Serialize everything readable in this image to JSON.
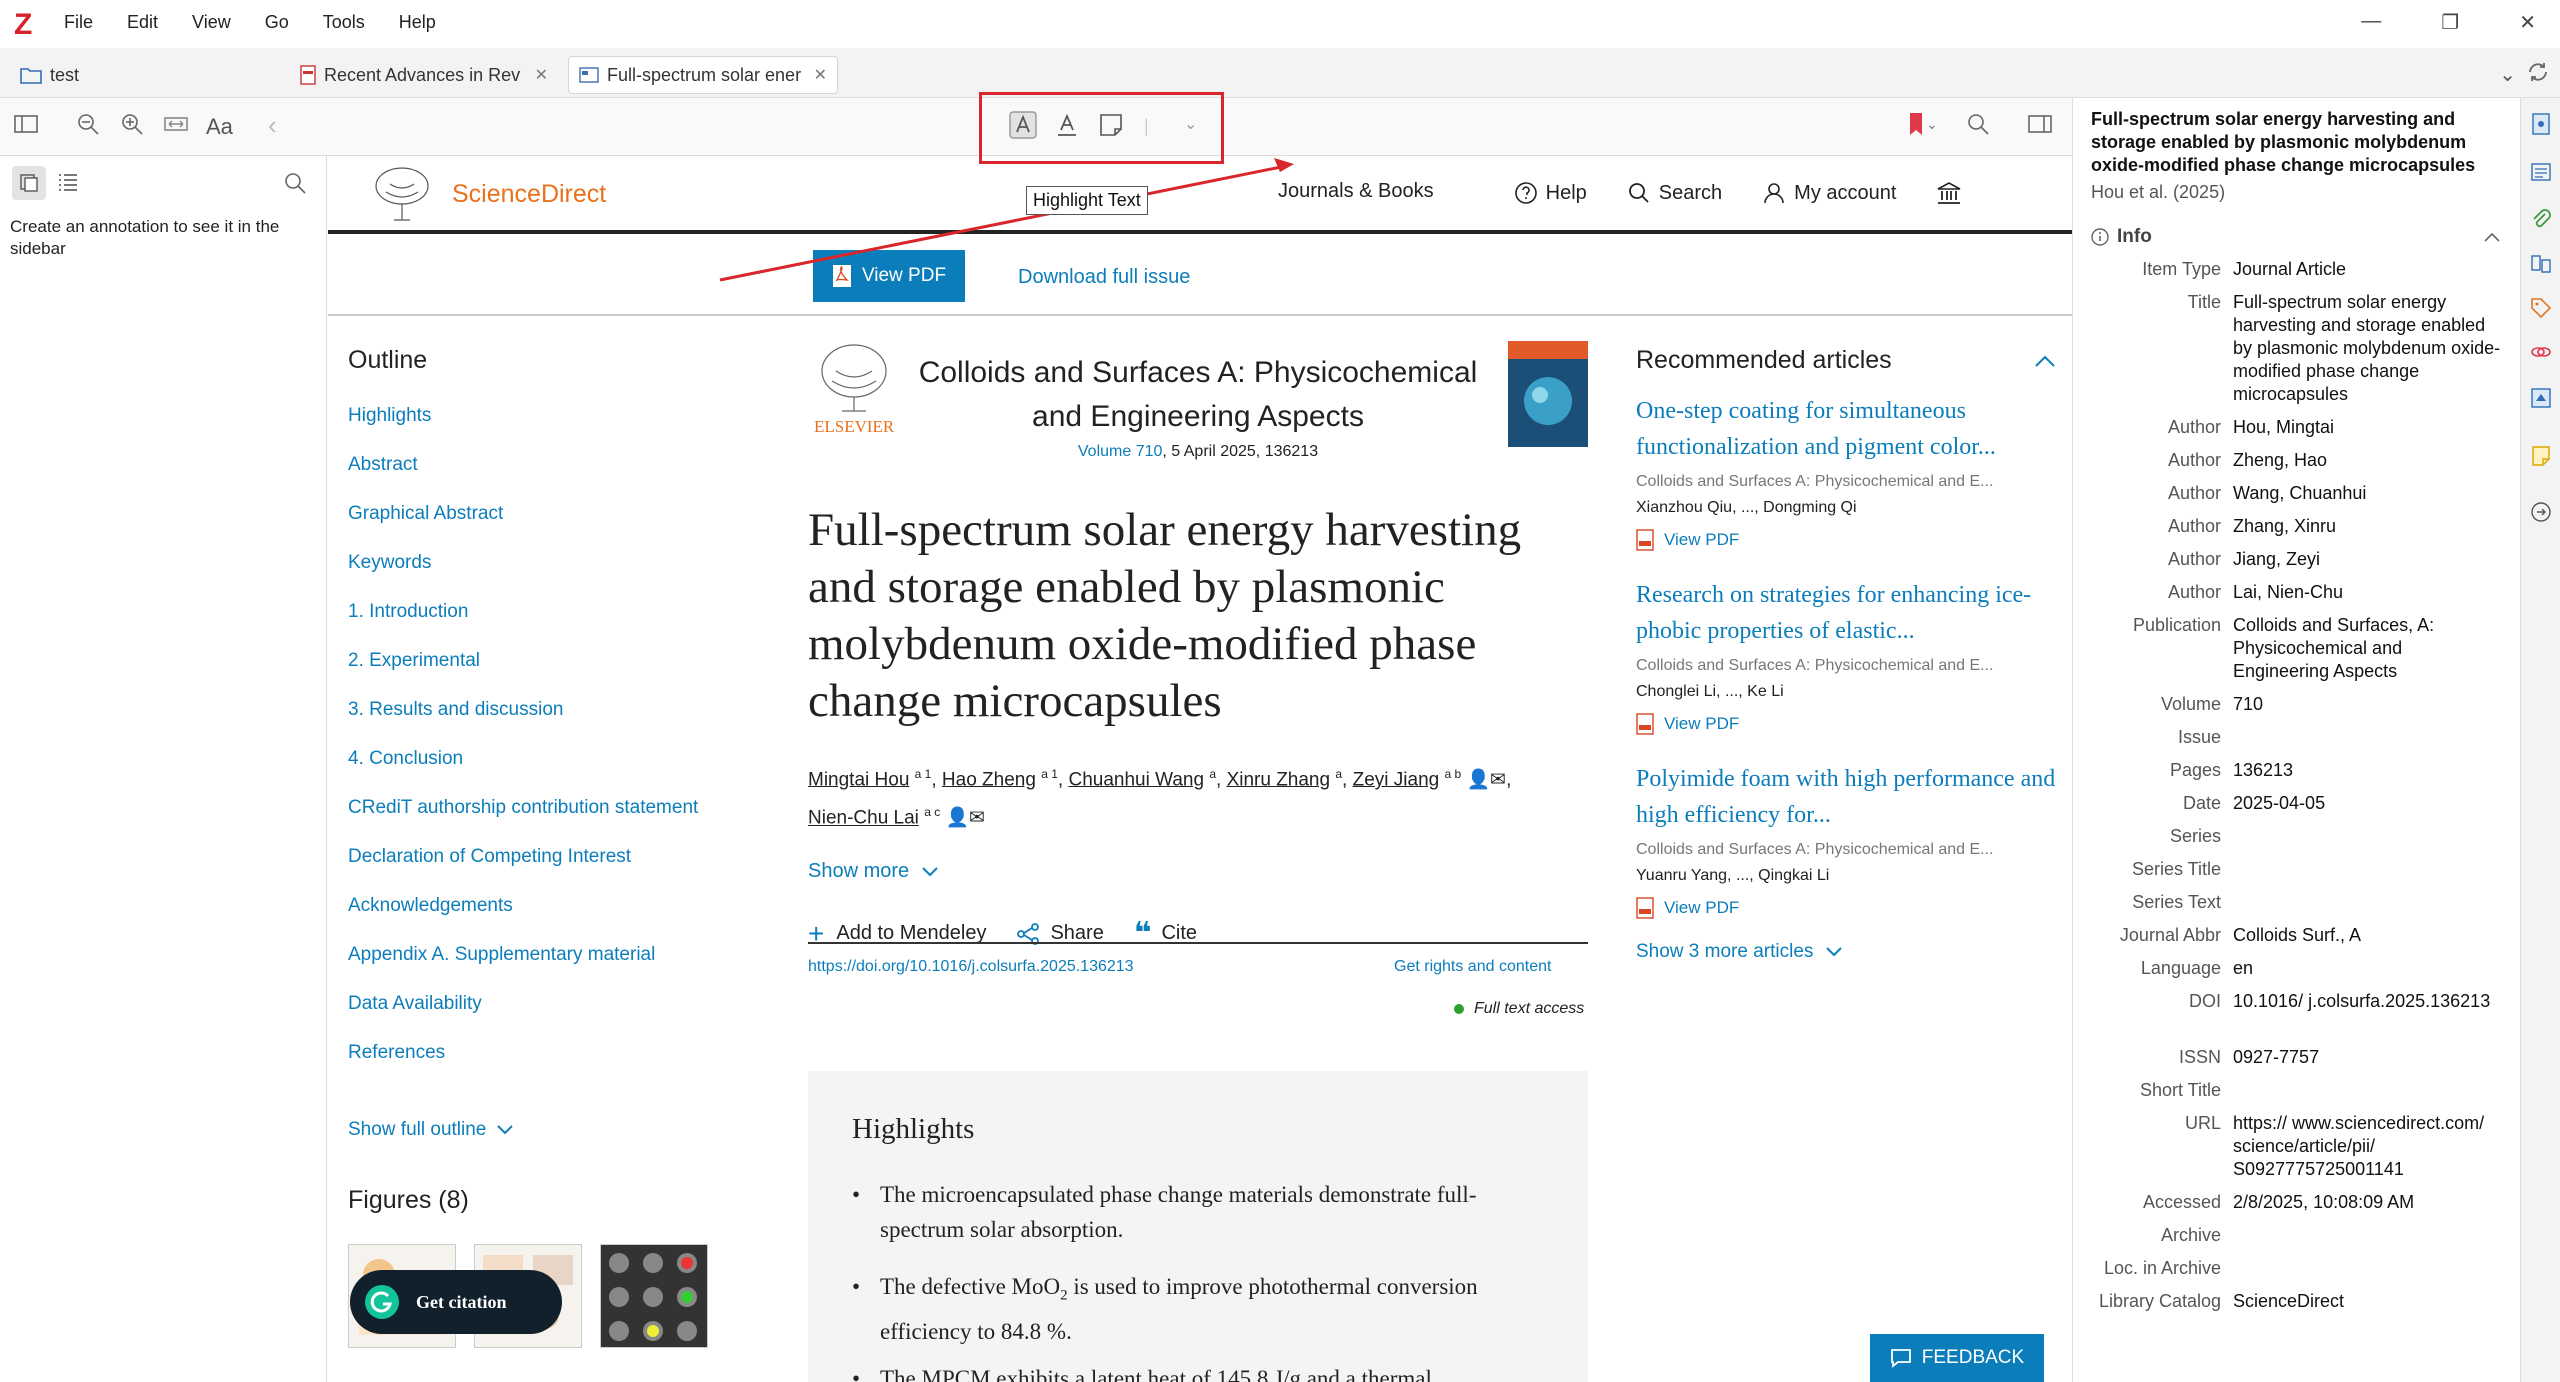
{
  "app": {
    "logo": "Z",
    "menus": [
      "File",
      "Edit",
      "View",
      "Go",
      "Tools",
      "Help"
    ]
  },
  "tabs": [
    {
      "label": "test",
      "icon": "folder-icon"
    },
    {
      "label": "Recent Advances in Rev",
      "icon": "pdf-icon"
    },
    {
      "label": "Full-spectrum solar ener",
      "icon": "web-snapshot-icon"
    }
  ],
  "toolbar": {
    "tooltip": "Highlight Text",
    "font_btn": "Aa"
  },
  "sidebar": {
    "empty_message": "Create an annotation to see it in the sidebar"
  },
  "sd": {
    "brand": "ScienceDirect",
    "nav": [
      "Journals & Books",
      "Help",
      "Search",
      "My account"
    ],
    "view_pdf": "View PDF",
    "download_issue": "Download full issue",
    "outline_title": "Outline",
    "outline": [
      "Highlights",
      "Abstract",
      "Graphical Abstract",
      "Keywords",
      "1. Introduction",
      "2. Experimental",
      "3. Results and discussion",
      "4. Conclusion",
      "CRediT authorship contribution statement",
      "Declaration of Competing Interest",
      "Acknowledgements",
      "Appendix A. Supplementary material",
      "Data Availability",
      "References"
    ],
    "show_full_outline": "Show full outline",
    "figures_title": "Figures (8)",
    "get_citation": "Get citation",
    "elsevier": "ELSEVIER",
    "journal_line1": "Colloids and Surfaces A: Physicochemical",
    "journal_line2": "and Engineering Aspects",
    "volume_link": "Volume 710",
    "volume_rest": ", 5 April 2025, 136213",
    "title_lines": [
      "Full-spectrum solar energy harvesting",
      "and storage enabled by plasmonic",
      "molybdenum oxide-modified phase",
      "change microcapsules"
    ],
    "authors": [
      {
        "name": "Mingtai Hou",
        "sup": "a 1"
      },
      {
        "name": "Hao Zheng",
        "sup": "a 1"
      },
      {
        "name": "Chuanhui Wang",
        "sup": "a"
      },
      {
        "name": "Xinru Zhang",
        "sup": "a"
      },
      {
        "name": "Zeyi Jiang",
        "sup": "a b"
      },
      {
        "name": "Nien-Chu Lai",
        "sup": "a c"
      }
    ],
    "show_more": "Show more",
    "add_mendeley": "Add to Mendeley",
    "share": "Share",
    "cite": "Cite",
    "doi": "https://doi.org/10.1016/j.colsurfa.2025.136213",
    "rights": "Get rights and content",
    "full_text": "Full text access",
    "recommended_title": "Recommended articles",
    "recommended": [
      {
        "title": "One-step coating for simultaneous functionalization and pigment color...",
        "meta": "Colloids and Surfaces A: Physicochemical and E...",
        "authors": "Xianzhou Qiu, ..., Dongming Qi",
        "pdf": "View PDF"
      },
      {
        "title": "Research on strategies for enhancing ice-phobic properties of elastic...",
        "meta": "Colloids and Surfaces A: Physicochemical and E...",
        "authors": "Chonglei Li, ..., Ke Li",
        "pdf": "View PDF"
      },
      {
        "title": "Polyimide foam with high performance and high efficiency for...",
        "meta": "Colloids and Surfaces A: Physicochemical and E...",
        "authors": "Yuanru Yang, ..., Qingkai Li",
        "pdf": "View PDF"
      }
    ],
    "show_more_articles": "Show 3 more articles",
    "highlights_title": "Highlights",
    "highlights": [
      "The microencapsulated phase change materials demonstrate full-spectrum solar absorption.",
      "The defective MoO2 is used to improve photothermal conversion efficiency to 84.8 %.",
      "The MPCM exhibits a latent heat of 145.8 J/g and a thermal"
    ],
    "feedback": "FEEDBACK"
  },
  "info": {
    "heading": "Full-spectrum solar energy harvesting and storage enabled by plasmonic molybdenum oxide-modified phase change microcapsules",
    "sub": "Hou et al. (2025)",
    "section": "Info",
    "rows": [
      {
        "k": "Item Type",
        "v": "Journal Article"
      },
      {
        "k": "Title",
        "v": "Full-spectrum solar energy harvesting and storage enabled by plasmonic molybdenum oxide-modified phase change microcapsules"
      },
      {
        "k": "Author",
        "v": "Hou, Mingtai"
      },
      {
        "k": "Author",
        "v": "Zheng, Hao"
      },
      {
        "k": "Author",
        "v": "Wang, Chuanhui"
      },
      {
        "k": "Author",
        "v": "Zhang, Xinru"
      },
      {
        "k": "Author",
        "v": "Jiang, Zeyi"
      },
      {
        "k": "Author",
        "v": "Lai, Nien-Chu"
      },
      {
        "k": "Publication",
        "v": "Colloids and Surfaces, A: Physicochemical and Engineering Aspects"
      },
      {
        "k": "Volume",
        "v": "710"
      },
      {
        "k": "Issue",
        "v": ""
      },
      {
        "k": "Pages",
        "v": "136213"
      },
      {
        "k": "Date",
        "v": "2025-04-05"
      },
      {
        "k": "Series",
        "v": ""
      },
      {
        "k": "Series Title",
        "v": ""
      },
      {
        "k": "Series Text",
        "v": ""
      },
      {
        "k": "Journal Abbr",
        "v": "Colloids Surf., A"
      },
      {
        "k": "Language",
        "v": "en"
      },
      {
        "k": "DOI",
        "v": "10.1016/ j.colsurfa.2025.136213"
      },
      {
        "k": "ISSN",
        "v": "0927-7757"
      },
      {
        "k": "Short Title",
        "v": ""
      },
      {
        "k": "URL",
        "v": "https:// www.sciencedirect.com/ science/article/pii/ S0927775725001141"
      },
      {
        "k": "Accessed",
        "v": "2/8/2025, 10:08:09 AM"
      },
      {
        "k": "Archive",
        "v": ""
      },
      {
        "k": "Loc. in Archive",
        "v": ""
      },
      {
        "k": "Library Catalog",
        "v": "ScienceDirect"
      }
    ]
  },
  "colors": {
    "accent": "#0c7dbb",
    "zotero_red": "#d7222b",
    "annotation_box": "#d9262b",
    "elsevier_orange": "#e9711c"
  }
}
